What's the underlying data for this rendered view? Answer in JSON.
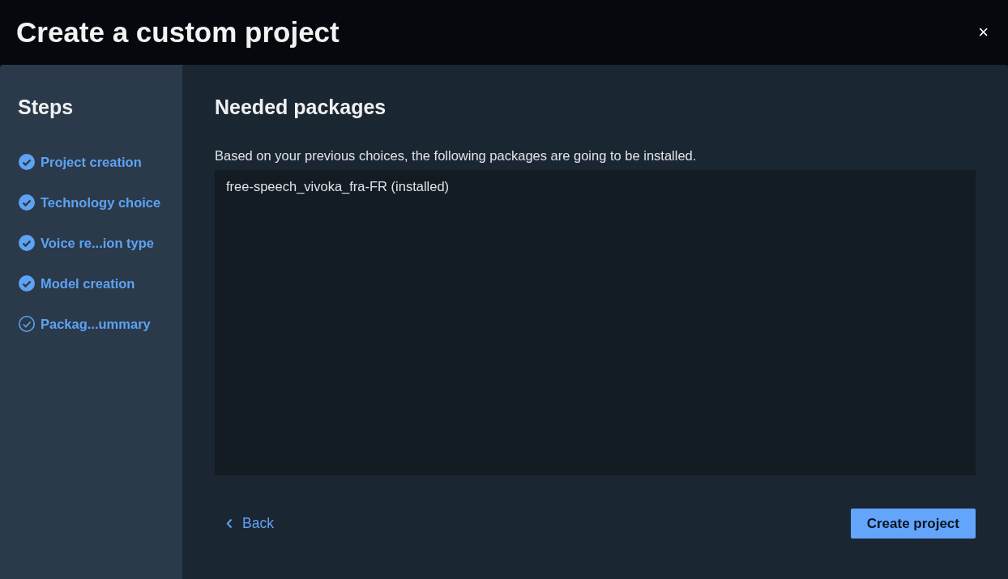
{
  "dialog": {
    "title": "Create a custom project",
    "close": "×"
  },
  "sidebar": {
    "title": "Steps",
    "steps": [
      {
        "label": "Project creation",
        "done": true
      },
      {
        "label": "Technology choice",
        "done": true
      },
      {
        "label": "Voice re...ion type",
        "done": true
      },
      {
        "label": "Model creation",
        "done": true
      },
      {
        "label": "Packag...ummary",
        "done": false
      }
    ]
  },
  "content": {
    "title": "Needed packages",
    "description": "Based on your previous choices, the following packages are going to be installed.",
    "packages": [
      "free-speech_vivoka_fra-FR (installed)"
    ]
  },
  "footer": {
    "back": "Back",
    "primary": "Create project"
  }
}
